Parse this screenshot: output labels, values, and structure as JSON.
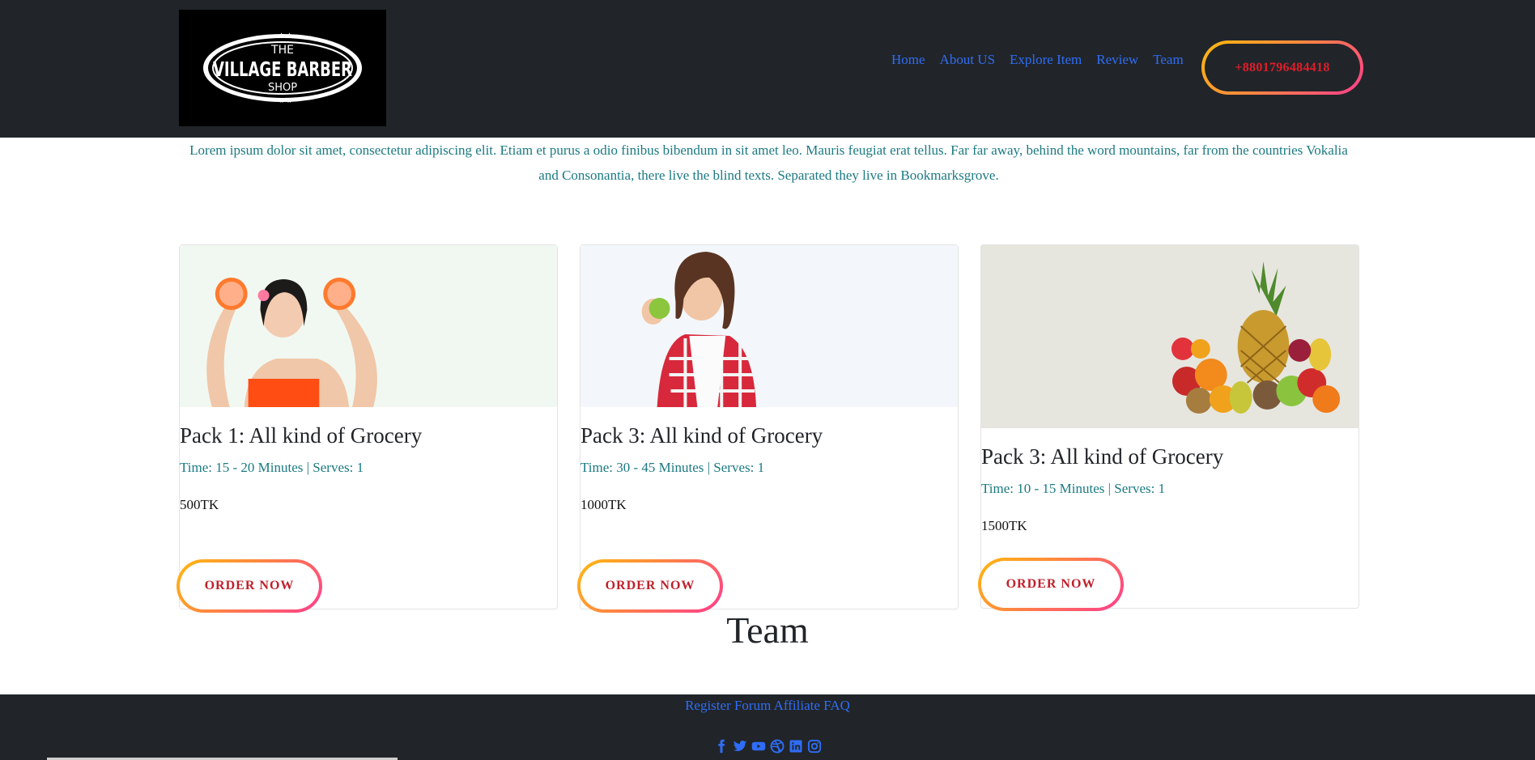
{
  "header": {
    "logo_text": {
      "top": "THE",
      "main": "VILLAGE BARBER",
      "bottom": "SHOP"
    },
    "nav": [
      {
        "label": "Home"
      },
      {
        "label": "About US"
      },
      {
        "label": "Explore Item"
      },
      {
        "label": "Review"
      },
      {
        "label": "Team"
      }
    ],
    "phone": "+8801796484418"
  },
  "intro": "Lorem ipsum dolor sit amet, consectetur adipiscing elit. Etiam et purus a odio finibus bibendum in sit amet leo. Mauris feugiat erat tellus. Far far away, behind the word mountains, far from the countries Vokalia and Consonantia, there live the blind texts. Separated they live in Bookmarksgrove.",
  "cards": [
    {
      "title": "Pack 1: All kind of Grocery",
      "time": "Time: 15 - 20 Minutes | Serves: 1",
      "price": "500TK",
      "button": "ORDER NOW"
    },
    {
      "title": "Pack 3: All kind of Grocery",
      "time": "Time: 30 - 45 Minutes | Serves: 1",
      "price": "1000TK",
      "button": "ORDER NOW"
    },
    {
      "title": "Pack 3: All kind of Grocery",
      "time": "Time: 10 - 15 Minutes | Serves: 1",
      "price": "1500TK",
      "button": "ORDER NOW"
    }
  ],
  "team_title": "Team",
  "footer": {
    "links": "Register Forum Affiliate FAQ",
    "socials": [
      "facebook-icon",
      "twitter-icon",
      "youtube-icon",
      "dribbble-icon",
      "linkedin-icon",
      "instagram-icon"
    ]
  },
  "colors": {
    "dark": "#212529",
    "link": "#2f6df6",
    "teal": "#1b7a82",
    "accent": "#e11d2a"
  }
}
